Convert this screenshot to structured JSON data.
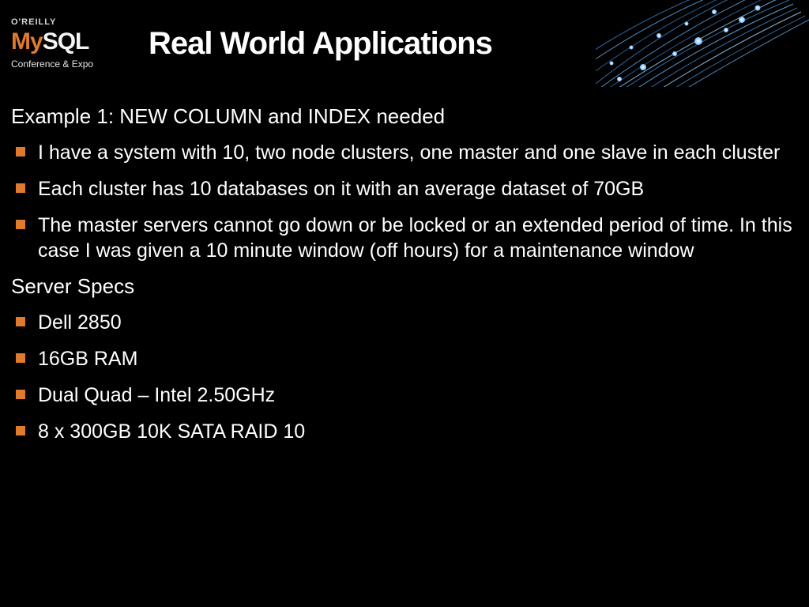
{
  "logo": {
    "brand_top": "O'REILLY",
    "brand_main_a": "My",
    "brand_main_b": "SQL",
    "tagline": "Conference & Expo"
  },
  "title": "Real World Applications",
  "section1": {
    "label": "Example 1: NEW COLUMN and INDEX needed",
    "bullets": [
      "I have a system with 10, two node clusters, one master and one slave in each cluster",
      "Each cluster has 10 databases on it with an average dataset of 70GB",
      "The master servers cannot go down or be locked or an extended period of time.  In this case I was given a 10 minute window (off hours) for a maintenance window"
    ]
  },
  "section2": {
    "label": "Server Specs",
    "bullets": [
      "Dell 2850",
      "16GB RAM",
      "Dual Quad – Intel 2.50GHz",
      "8 x 300GB 10K SATA RAID 10"
    ]
  },
  "colors": {
    "accent": "#e07a2c",
    "bg": "#000000",
    "text": "#ffffff"
  }
}
